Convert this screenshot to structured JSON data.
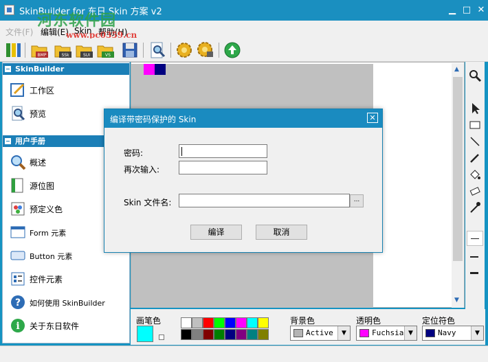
{
  "window": {
    "title": "SkinBuilder for 东日 Skin 方案 v2"
  },
  "watermark": {
    "text": "河东软件园",
    "url": "www.pc0359.cn"
  },
  "menu": [
    "文件(F)",
    "编辑(E)",
    "Skin",
    "帮助(H)"
  ],
  "toolbar": {
    "icons": [
      "new-icon",
      "open-bmp-icon",
      "open-ssk-icon",
      "open-sui-icon",
      "open-vs-icon",
      "save-icon",
      "preview-icon",
      "compile-icon",
      "compile-password-icon",
      "update-icon"
    ],
    "labels": {
      "bmp": "BMP",
      "ssk": "SSk",
      "sui": "SUI",
      "vs": "VS"
    }
  },
  "left_panel": {
    "section1": {
      "title": "SkinBuilder",
      "items": [
        {
          "label": "工作区",
          "icon": "edit-icon"
        },
        {
          "label": "预览",
          "icon": "preview-icon"
        }
      ]
    },
    "section2": {
      "title": "用户手册",
      "items": [
        {
          "label": "概述",
          "icon": "magnifier-icon"
        },
        {
          "label": "源位图",
          "icon": "bitmap-icon"
        },
        {
          "label": "预定义色",
          "icon": "palette-icon"
        },
        {
          "label": "Form 元素",
          "icon": "form-icon"
        },
        {
          "label": "Button 元素",
          "icon": "button-icon"
        },
        {
          "label": "控件元素",
          "icon": "controls-icon"
        },
        {
          "label": "如何使用 SkinBuilder",
          "icon": "help-icon"
        },
        {
          "label": "关于东日软件",
          "icon": "info-icon"
        }
      ]
    }
  },
  "palette": {
    "pen_label": "画笔色",
    "pen_color": "#00ffff",
    "colors_row1": [
      "#ffffff",
      "#c0c0c0",
      "#ff0000",
      "#00ff00",
      "#0000ff",
      "#ff00ff",
      "#00ffff",
      "#ffff00"
    ],
    "colors_row2": [
      "#000000",
      "#808080",
      "#800000",
      "#008000",
      "#000080",
      "#800080",
      "#008080",
      "#808000"
    ],
    "background": {
      "label": "背景色",
      "value": "Active B",
      "color": "#b4b4b4"
    },
    "transparent": {
      "label": "透明色",
      "value": "Fuchsia",
      "color": "#ff00ff"
    },
    "locator": {
      "label": "定位符色",
      "value": "Navy",
      "color": "#000080"
    }
  },
  "canvas": {
    "top_swatches": [
      "#ff00ff",
      "#000080"
    ]
  },
  "dialog": {
    "title": "编译带密码保护的 Skin",
    "password_label": "密码:",
    "password_value": "",
    "confirm_label": "再次输入:",
    "confirm_value": "",
    "file_label": "Skin 文件名:",
    "file_value": "",
    "browse_label": "...",
    "compile_label": "编译",
    "cancel_label": "取消"
  }
}
